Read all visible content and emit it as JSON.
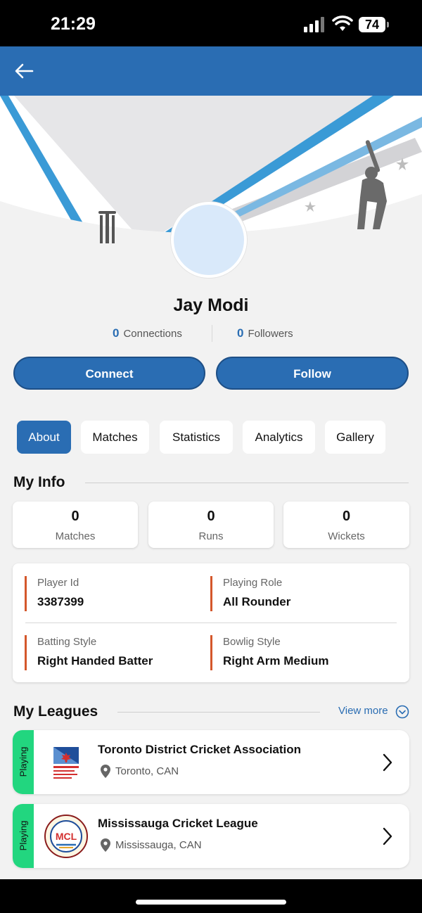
{
  "status_bar": {
    "time": "21:29",
    "battery": "74"
  },
  "profile": {
    "name": "Jay Modi",
    "connections_count": "0",
    "connections_label": "Connections",
    "followers_count": "0",
    "followers_label": "Followers"
  },
  "actions": {
    "connect": "Connect",
    "follow": "Follow"
  },
  "tabs": [
    {
      "label": "About",
      "active": true
    },
    {
      "label": "Matches",
      "active": false
    },
    {
      "label": "Statistics",
      "active": false
    },
    {
      "label": "Analytics",
      "active": false
    },
    {
      "label": "Gallery",
      "active": false
    }
  ],
  "my_info": {
    "title": "My Info",
    "stats": [
      {
        "value": "0",
        "label": "Matches"
      },
      {
        "value": "0",
        "label": "Runs"
      },
      {
        "value": "0",
        "label": "Wickets"
      }
    ],
    "details": [
      {
        "label": "Player Id",
        "value": "3387399"
      },
      {
        "label": "Playing Role",
        "value": "All Rounder"
      },
      {
        "label": "Batting Style",
        "value": "Right Handed Batter"
      },
      {
        "label": "Bowlig Style",
        "value": "Right Arm Medium"
      }
    ]
  },
  "my_leagues": {
    "title": "My Leagues",
    "view_more": "View more",
    "items": [
      {
        "status": "Playing",
        "name": "Toronto District Cricket Association",
        "location": "Toronto, CAN",
        "logo_text": "TORONTO & DISTRICT CRICKET ASSOCIATION"
      },
      {
        "status": "Playing",
        "name": "Mississauga Cricket League",
        "location": "Mississauga, CAN",
        "logo_text": "MCL"
      }
    ]
  },
  "colors": {
    "primary": "#2a6db3",
    "accent": "#d4572b",
    "playing": "#22d67f",
    "background": "#f2f2f2"
  }
}
